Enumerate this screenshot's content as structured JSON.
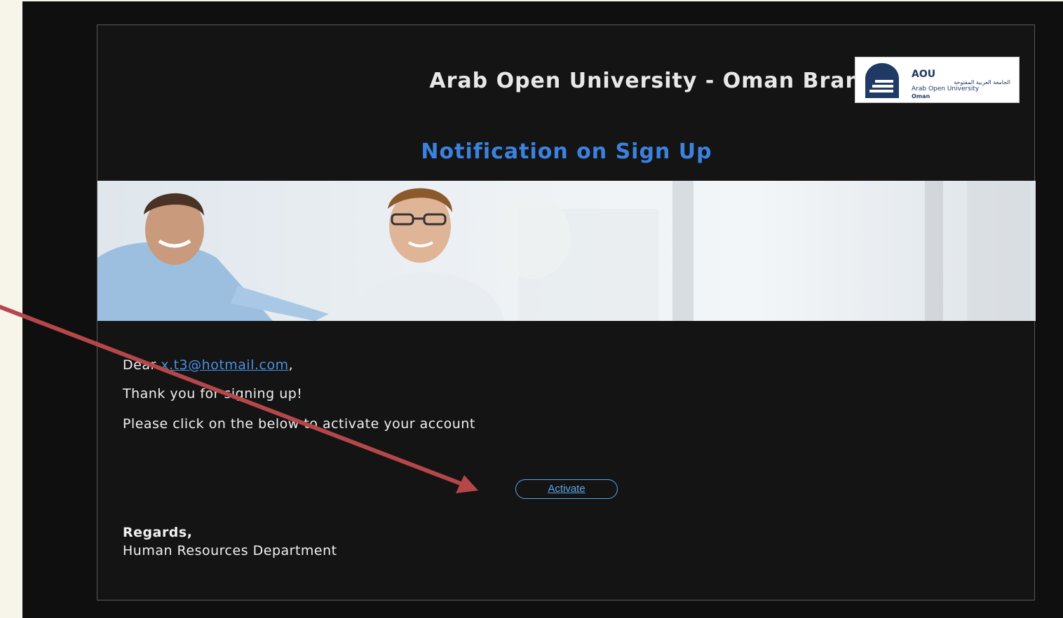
{
  "email": {
    "header_title": "Arab Open University - Oman Branch",
    "logo": {
      "abbr": "AOU",
      "arabic": "الجامعة العربية المفتوحة",
      "english": "Arab Open University",
      "city": "Oman",
      "icon": "aou-logo-icon"
    },
    "subject": "Notification on Sign Up",
    "banner_icon": "people-banner-image",
    "greeting_prefix": "Dear ",
    "recipient_email": "x.t3@hotmail.com",
    "greeting_suffix": ",",
    "line1": "Thank you for signing up!",
    "line2": "Please click on the below to activate your account",
    "activate_label": "Activate",
    "regards": "Regards,",
    "department": "Human Resources Department"
  },
  "annotation": {
    "icon": "red-arrow-icon",
    "color": "#b5474b"
  },
  "colors": {
    "background": "#141414",
    "subject": "#3b82e0",
    "link": "#4a90e2",
    "button": "#5aa7e6"
  }
}
